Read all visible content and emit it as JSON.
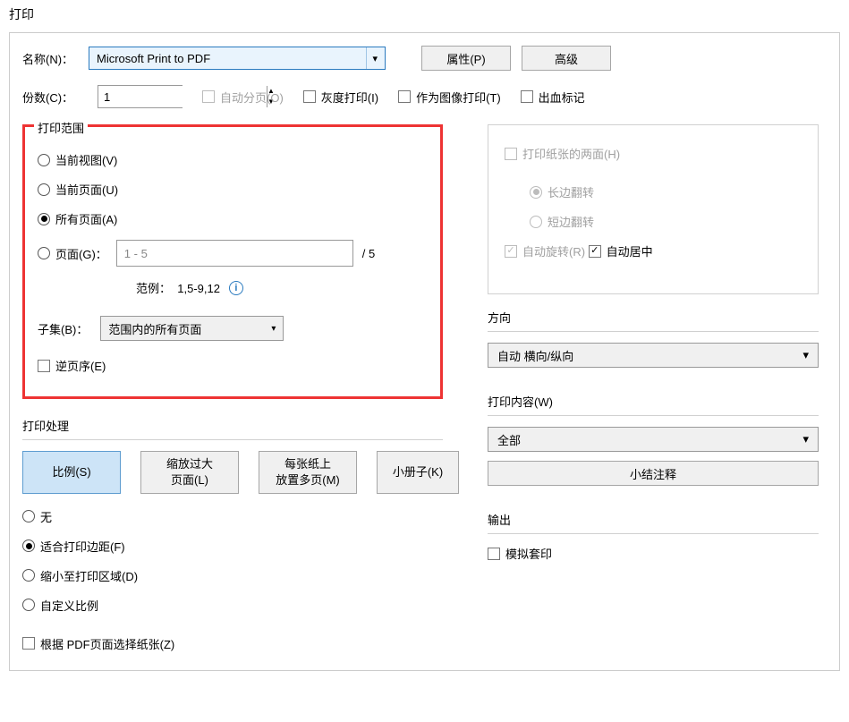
{
  "dialog": {
    "title": "打印"
  },
  "printer": {
    "name_label": "名称(N)：",
    "selected": "Microsoft Print to PDF",
    "properties": "属性(P)",
    "advanced": "高级"
  },
  "copies": {
    "label": "份数(C)：",
    "value": "1",
    "collate": "自动分页(O)",
    "grayscale": "灰度打印(I)",
    "as_image": "作为图像打印(T)",
    "bleed": "出血标记"
  },
  "range": {
    "title": "打印范围",
    "current_view": "当前视图(V)",
    "current_page": "当前页面(U)",
    "all_pages": "所有页面(A)",
    "pages_label": "页面(G)：",
    "pages_placeholder": "1 - 5",
    "page_total": "/ 5",
    "example_label": "范例：",
    "example_value": "1,5-9,12",
    "subset_label": "子集(B)：",
    "subset_selected": "范围内的所有页面",
    "reverse": "逆页序(E)"
  },
  "double": {
    "both_sides": "打印纸张的两面(H)",
    "long_edge": "长边翻转",
    "short_edge": "短边翻转",
    "auto_rotate": "自动旋转(R)",
    "auto_center": "自动居中"
  },
  "handling": {
    "title": "打印处理",
    "tab_scale": "比例(S)",
    "tab_shrink": "缩放过大\n页面(L)",
    "tab_multi": "每张纸上\n放置多页(M)",
    "tab_booklet": "小册子(K)",
    "opt_none": "无",
    "opt_fit_margin": "适合打印边距(F)",
    "opt_shrink": "缩小至打印区域(D)",
    "opt_custom": "自定义比例",
    "opt_paper_from_pdf": "根据 PDF页面选择纸张(Z)"
  },
  "orientation": {
    "title": "方向",
    "selected": "自动 横向/纵向"
  },
  "content": {
    "title": "打印内容(W)",
    "selected": "全部",
    "summary_btn": "小结注释"
  },
  "output": {
    "title": "输出",
    "simulate": "模拟套印"
  }
}
